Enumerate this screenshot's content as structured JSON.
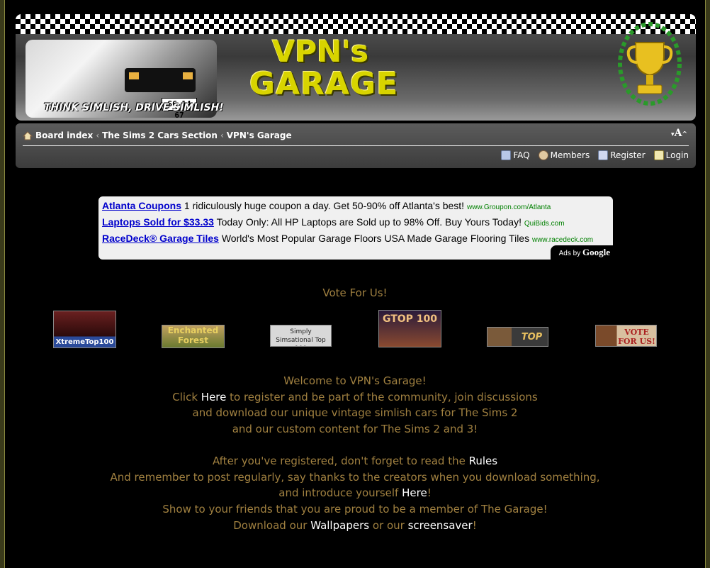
{
  "banner": {
    "slogan": "THINK SIMLISH, DRIVE SIMLISH!",
    "plate": "SC 14 67",
    "logo_line1": "VPN's",
    "logo_line2": "GARAGE"
  },
  "breadcrumb": {
    "items": [
      "Board index",
      "The Sims 2 Cars Section",
      "VPN's Garage"
    ],
    "separator": "‹"
  },
  "font_size_control": "A",
  "nav": {
    "faq": "FAQ",
    "members": "Members",
    "register": "Register",
    "login": "Login"
  },
  "ads": [
    {
      "title": "Atlanta Coupons",
      "text": " 1 ridiculously huge coupon a day. Get 50-90% off Atlanta's best! ",
      "url": "www.Groupon.com/Atlanta"
    },
    {
      "title": "Laptops Sold for $33.33",
      "text": " Today Only: All HP Laptops are Sold up to 98% Off. Buy Yours Today! ",
      "url": "QuiBids.com"
    },
    {
      "title": "RaceDeck® Garage Tiles",
      "text": " World's Most Popular Garage Floors USA Made Garage Flooring Tiles ",
      "url": "www.racedeck.com"
    }
  ],
  "ads_by": {
    "prefix": "Ads by ",
    "brand": "Google"
  },
  "vote": {
    "title": "Vote For Us!",
    "buttons": [
      "XtremeTop100",
      "Enchanted Forest",
      "Simply Simsational Top 100",
      "GTOP 100",
      "TOP",
      "VOTE FOR US!"
    ]
  },
  "welcome": {
    "line1": "Welcome to VPN's Garage!",
    "line2_a": "Click ",
    "line2_link": "Here",
    "line2_b": " to register and be part of the community, join discussions",
    "line3": "and download our unique vintage simlish cars for The Sims 2",
    "line4": "and our custom content for The Sims 2 and 3!",
    "line5_a": "After you've registered, don't forget to read the ",
    "line5_link": "Rules",
    "line6": "And remember to post regularly, say thanks to the creators when you download something,",
    "line7_a": "and introduce yourself ",
    "line7_link": "Here",
    "line7_b": "!",
    "line8": "Show to your friends that you are proud to be a member of The Garage!",
    "line9_a": "Download our ",
    "line9_link1": "Wallpapers",
    "line9_b": " or our ",
    "line9_link2": "screensaver",
    "line9_c": "!"
  }
}
